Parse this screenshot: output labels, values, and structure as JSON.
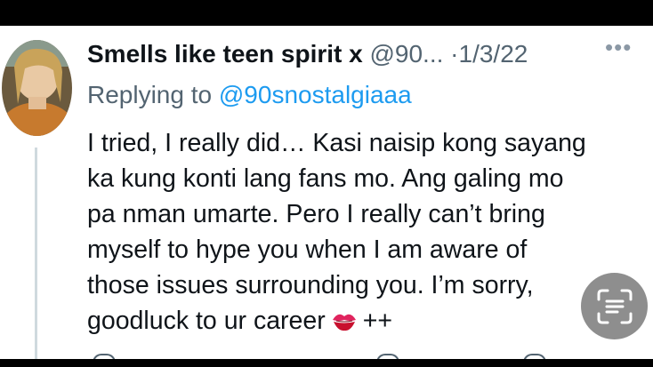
{
  "tweet": {
    "display_name": "Smells like teen spirit x",
    "handle": "@90...",
    "separator": "·",
    "date": "1/3/22",
    "more_label": "•••",
    "reply_prefix": "Replying to ",
    "reply_handle": "@90snostalgiaaa",
    "body_lines": [
      "I tried, I really did… Kasi naisip kong sayang",
      "ka kung konti lang fans mo. Ang galing mo",
      "pa nman umarte. Pero I really can’t bring",
      "myself to hype you when I am aware of",
      "those issues surrounding you. I’m sorry,",
      "goodluck to ur career",
      "++"
    ]
  },
  "icons": {
    "avatar": "profile-photo",
    "kiss": "kiss-mark-emoji",
    "scan": "live-text-scan-icon",
    "more": "more-options-icon"
  },
  "colors": {
    "text": "#0f1419",
    "muted": "#536471",
    "link": "#1d9bf0",
    "thread_line": "#cfd9de",
    "scan_button": "#6e6e6e"
  }
}
